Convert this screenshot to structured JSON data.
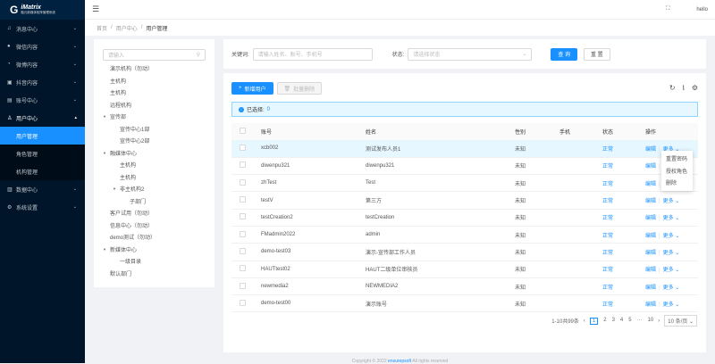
{
  "brand": {
    "name": "iMatrix",
    "subtitle": "融元新媒体矩阵管理系统"
  },
  "sidebar": {
    "items": [
      {
        "label": "消息中心",
        "icon": "bell-icon"
      },
      {
        "label": "微信内容",
        "icon": "wechat-icon"
      },
      {
        "label": "微博内容",
        "icon": "weibo-icon"
      },
      {
        "label": "抖音内容",
        "icon": "video-icon"
      },
      {
        "label": "账号中心",
        "icon": "account-icon"
      },
      {
        "label": "用户中心",
        "icon": "user-icon"
      },
      {
        "label": "数据中心",
        "icon": "chart-icon"
      },
      {
        "label": "系统设置",
        "icon": "gear-icon"
      }
    ],
    "sub": [
      {
        "label": "用户管理"
      },
      {
        "label": "角色管理"
      },
      {
        "label": "机构管理"
      }
    ]
  },
  "header": {
    "user": "hello"
  },
  "breadcrumb": [
    "首页",
    "用户中心",
    "用户管理"
  ],
  "tree": {
    "placeholder": "请输入",
    "nodes": [
      {
        "label": "演示机构（勿动）",
        "level": 0
      },
      {
        "label": "主机构",
        "level": 0
      },
      {
        "label": "主机构",
        "level": 0
      },
      {
        "label": "远程机构",
        "level": 0
      },
      {
        "label": "宣传部",
        "level": 0,
        "open": true
      },
      {
        "label": "宣传中心1部",
        "level": 1
      },
      {
        "label": "宣传中心2部",
        "level": 1
      },
      {
        "label": "融媒体中心",
        "level": 0,
        "open": true
      },
      {
        "label": "主机构",
        "level": 1
      },
      {
        "label": "主机构",
        "level": 1
      },
      {
        "label": "非主机构2",
        "level": 1,
        "open": true
      },
      {
        "label": "子部门",
        "level": 2
      },
      {
        "label": "客户试用（勿动）",
        "level": 0
      },
      {
        "label": "信息中心（勿动）",
        "level": 0
      },
      {
        "label": "demo测试（勿动）",
        "level": 0
      },
      {
        "label": "新媒体中心",
        "level": 0,
        "open": true
      },
      {
        "label": "一级目录",
        "level": 1
      },
      {
        "label": "默认部门",
        "level": 0
      }
    ]
  },
  "filter": {
    "keyword_label": "关键词:",
    "keyword_placeholder": "请输入姓名、账号、手机号",
    "status_label": "状态:",
    "status_placeholder": "请选择状态",
    "query": "查 询",
    "reset": "重 置"
  },
  "toolbar": {
    "add": "新增用户",
    "batch_delete": "批量删除"
  },
  "alert": {
    "label": "已选择:",
    "count": "0"
  },
  "table": {
    "columns": [
      "账号",
      "姓名",
      "性别",
      "手机",
      "状态",
      "操作"
    ],
    "rows": [
      [
        "xcb002",
        "测试发布人员1",
        "未知",
        "",
        "正常"
      ],
      [
        "diwenpu321",
        "diwenpu321",
        "未知",
        "",
        "正常"
      ],
      [
        "zhTest",
        "Test",
        "未知",
        "",
        "正常"
      ],
      [
        "testV",
        "第三方",
        "未知",
        "",
        "正常"
      ],
      [
        "testCreation2",
        "testCreation",
        "未知",
        "",
        "正常"
      ],
      [
        "FMadmin2022",
        "admin",
        "未知",
        "",
        "正常"
      ],
      [
        "demo-test03",
        "演示-宣传部工作人员",
        "未知",
        "",
        "正常"
      ],
      [
        "HAUTtest02",
        "HAUT二级单位审核员",
        "未知",
        "",
        "正常"
      ],
      [
        "newmedia2",
        "NEWMEDIA2",
        "未知",
        "",
        "正常"
      ],
      [
        "demo-test00",
        "演示账号",
        "未知",
        "",
        "正常"
      ]
    ],
    "edit": "编辑",
    "more": "更多"
  },
  "dropdown": [
    "重置密码",
    "授权角色",
    "删除"
  ],
  "pagination": {
    "total": "1-10共99条",
    "pages": [
      "1",
      "2",
      "3",
      "4",
      "5",
      "···",
      "10"
    ],
    "size": "10 条/页"
  },
  "footer": {
    "text": "Copyright © 2022",
    "link": "ensurepsoft",
    "suffix": "All rights reserved"
  }
}
